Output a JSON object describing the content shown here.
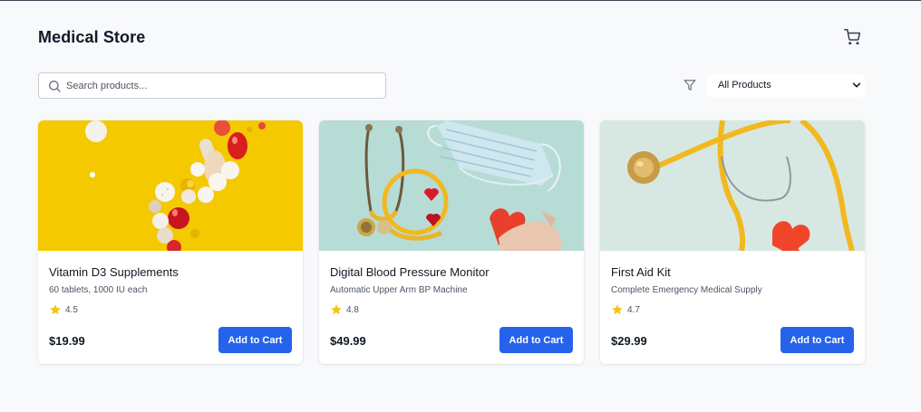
{
  "header": {
    "title": "Medical Store",
    "cart_icon": "cart-icon"
  },
  "search": {
    "placeholder": "Search products...",
    "value": "",
    "icon": "search-icon"
  },
  "filter": {
    "icon": "filter-icon",
    "selected": "All Products"
  },
  "colors": {
    "accent": "#2563eb",
    "star": "#f5c518",
    "background": "#f8f9fb"
  },
  "products": [
    {
      "name": "Vitamin D3 Supplements",
      "description": "60 tablets, 1000 IU each",
      "rating": "4.5",
      "price": "$19.99",
      "button": "Add to Cart",
      "image": "pills-on-yellow-image"
    },
    {
      "name": "Digital Blood Pressure Monitor",
      "description": "Automatic Upper Arm BP Machine",
      "rating": "4.8",
      "price": "$49.99",
      "button": "Add to Cart",
      "image": "stethoscope-mask-hearts-image"
    },
    {
      "name": "First Aid Kit",
      "description": "Complete Emergency Medical Supply",
      "rating": "4.7",
      "price": "$29.99",
      "button": "Add to Cart",
      "image": "stethoscope-heart-image"
    }
  ]
}
